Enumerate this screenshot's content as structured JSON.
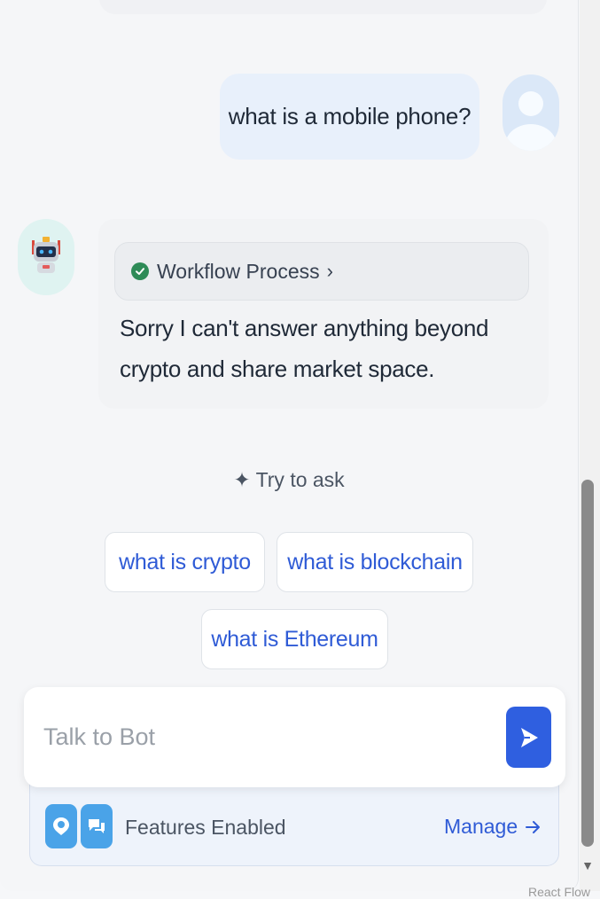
{
  "chat": {
    "user_message": "what is a mobile phone?",
    "bot_workflow_label": "Workflow Process",
    "bot_reply": "Sorry I can't answer anything beyond crypto and share market space."
  },
  "suggestions": {
    "heading": "Try to ask",
    "items": [
      "what is crypto",
      "what is blockchain",
      "what is Ethereum"
    ]
  },
  "composer": {
    "placeholder": "Talk to Bot"
  },
  "features": {
    "label": "Features Enabled",
    "manage_label": "Manage",
    "icons": [
      "chat-pin-icon",
      "chat-bubbles-icon"
    ]
  },
  "footer": {
    "watermark": "React Flow"
  },
  "colors": {
    "accent": "#2f5fe0",
    "link": "#2f5bd6",
    "success": "#2e8b57"
  }
}
